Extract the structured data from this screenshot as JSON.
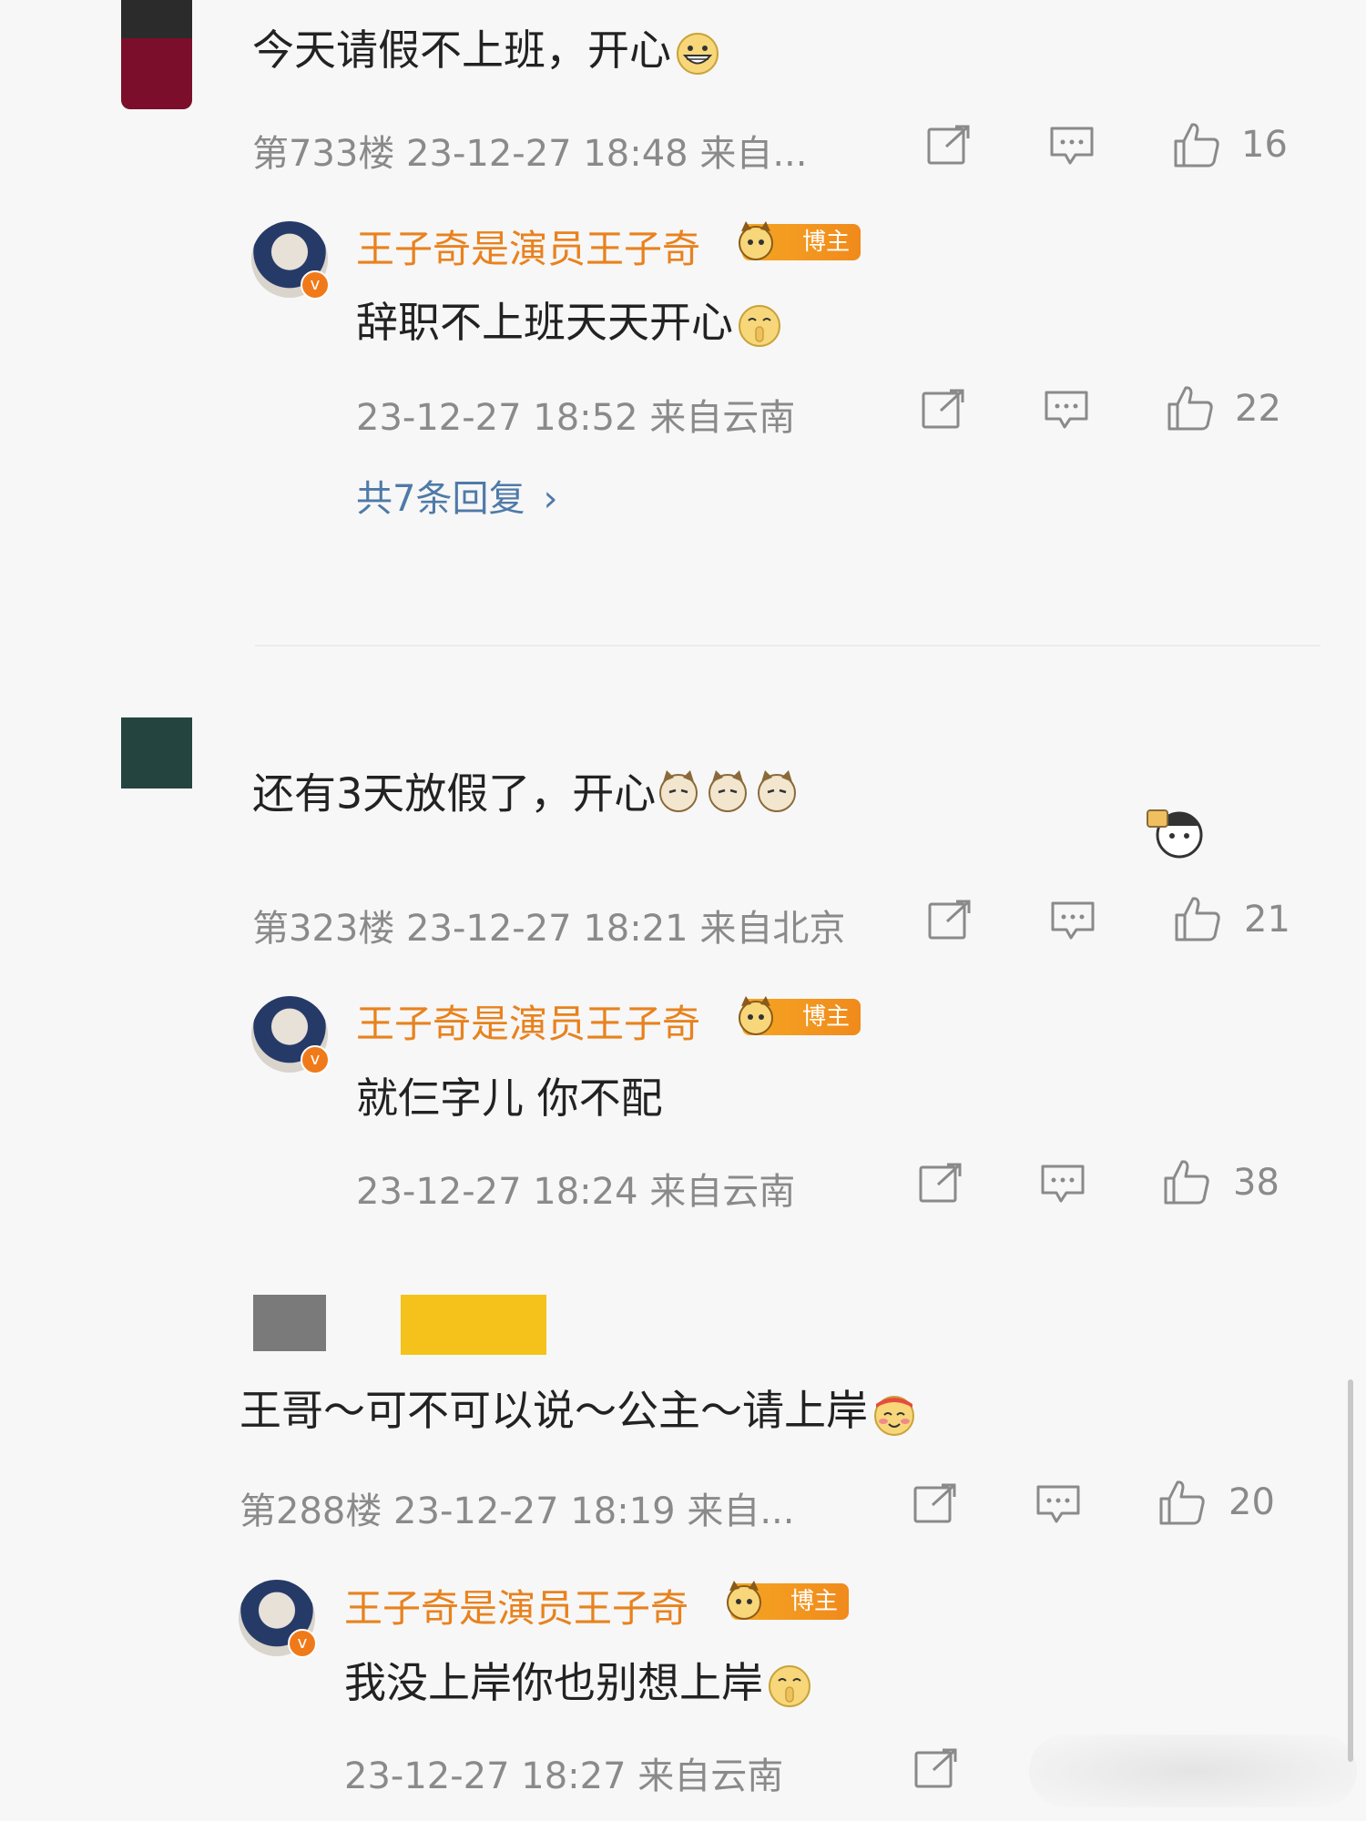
{
  "comments": [
    {
      "text": "今天请假不上班，开心",
      "meta": "第733楼 23-12-27 18:48 来自...",
      "likes": "16",
      "avatar_colors": [
        "#2b2b2b",
        "#7b0f2b"
      ],
      "emoji": "grin-emoji",
      "reply": {
        "name": "王子奇是演员王子奇",
        "badge": "博主",
        "text": "辞职不上班天天开心",
        "emoji": "shush-emoji",
        "meta": "23-12-27 18:52 来自云南",
        "likes": "22",
        "more": "共7条回复"
      }
    },
    {
      "text": "还有3天放假了，开心",
      "meta": "第323楼 23-12-27 18:21 来自北京",
      "likes": "21",
      "avatar_colors": [
        "#24453f"
      ],
      "emoji": "cat-emoji",
      "reply": {
        "name": "王子奇是演员王子奇",
        "badge": "博主",
        "text": "就仨字儿 你不配",
        "meta": "23-12-27 18:24 来自云南",
        "likes": "38"
      }
    },
    {
      "text": "王哥～可不可以说～公主～请上岸",
      "meta": "第288楼 23-12-27 18:19 来自...",
      "likes": "20",
      "avatar_colors": [
        "#7a7a7a",
        "#f4c21b"
      ],
      "emoji": "blush-emoji",
      "reply": {
        "name": "王子奇是演员王子奇",
        "badge": "博主",
        "text": "我没上岸你也别想上岸",
        "emoji": "shush-emoji",
        "meta": "23-12-27 18:27 来自云南"
      }
    }
  ],
  "colors": {
    "page_bg": "#f7f7f7",
    "name": "#e8821e",
    "meta": "#8a8a8a",
    "link": "#4f7aa8",
    "badge": "#f08a1c"
  },
  "icons": [
    "share-icon",
    "comment-icon",
    "like-icon"
  ]
}
